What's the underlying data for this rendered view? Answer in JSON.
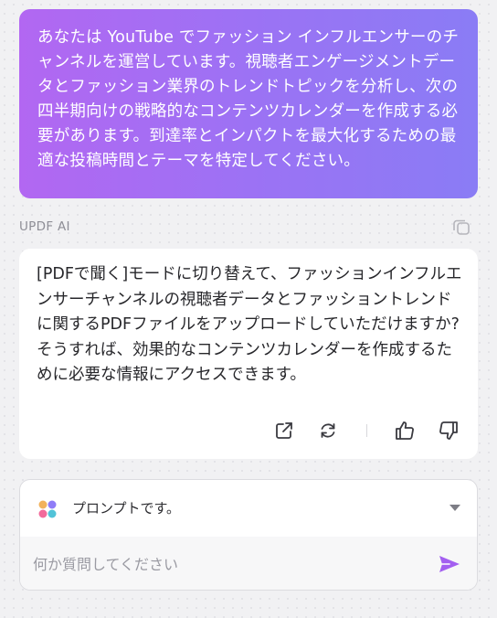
{
  "user_message": {
    "text": "あなたは YouTube でファッション インフルエンサーのチャンネルを運営しています。視聴者エンゲージメントデータとファッション業界のトレンドトピックを分析し、次の四半期向けの戦略的なコンテンツカレンダーを作成する必要があります。到達率とインパクトを最大化するための最適な投稿時間とテーマを特定してください。",
    "gradient_start": "#b267f2",
    "gradient_end": "#8a7cf5"
  },
  "ai_response": {
    "label": "UPDF AI",
    "text": "[PDFで聞く]モードに切り替えて、ファッションインフルエンサーチャンネルの視聴者データとファッショントレンドに関するPDFファイルをアップロードしていただけますか? そうすれば、効果的なコンテンツカレンダーを作成するために必要な情報にアクセスできます。",
    "actions": [
      "external-link-icon",
      "regenerate-icon",
      "thumbs-up-icon",
      "thumbs-down-icon"
    ]
  },
  "input": {
    "prompt_selector_label": "プロンプトです。",
    "placeholder": "何か質問してください",
    "value": "",
    "send_color": "#a35ff0"
  }
}
